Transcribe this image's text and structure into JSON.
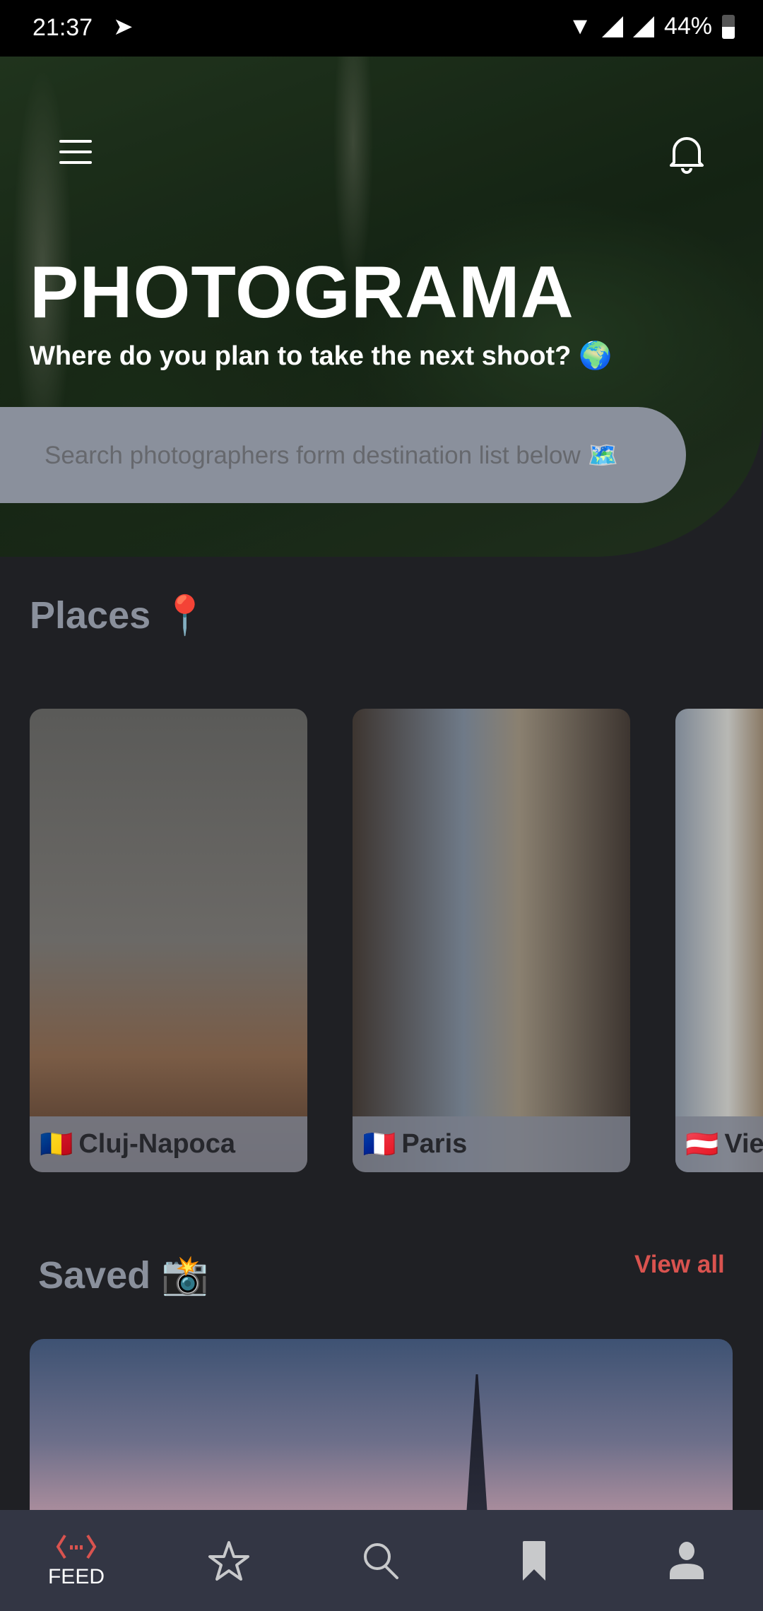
{
  "status_bar": {
    "time": "21:37",
    "battery": "44%"
  },
  "header": {
    "title": "PHOTOGRAMA",
    "subtitle": "Where do you plan to take the next shoot? 🌍"
  },
  "search": {
    "placeholder": "Search photographers form destination list below 🗺️"
  },
  "places": {
    "heading": "Places 📍",
    "items": [
      {
        "flag": "🇷🇴",
        "name": "Cluj-Napoca"
      },
      {
        "flag": "🇫🇷",
        "name": "Paris"
      },
      {
        "flag": "🇦🇹",
        "name": "Vienna"
      }
    ]
  },
  "saved": {
    "heading": "Saved 📸",
    "view_all": "View all"
  },
  "nav": {
    "items": [
      {
        "icon": "feed-icon",
        "label": "FEED",
        "active": true
      },
      {
        "icon": "star-icon"
      },
      {
        "icon": "search-icon"
      },
      {
        "icon": "bookmark-icon"
      },
      {
        "icon": "profile-icon"
      }
    ]
  },
  "colors": {
    "accent": "#d9534f",
    "nav_bg": "#333644",
    "bg": "#1f2024",
    "search_bg": "#8a909c"
  }
}
